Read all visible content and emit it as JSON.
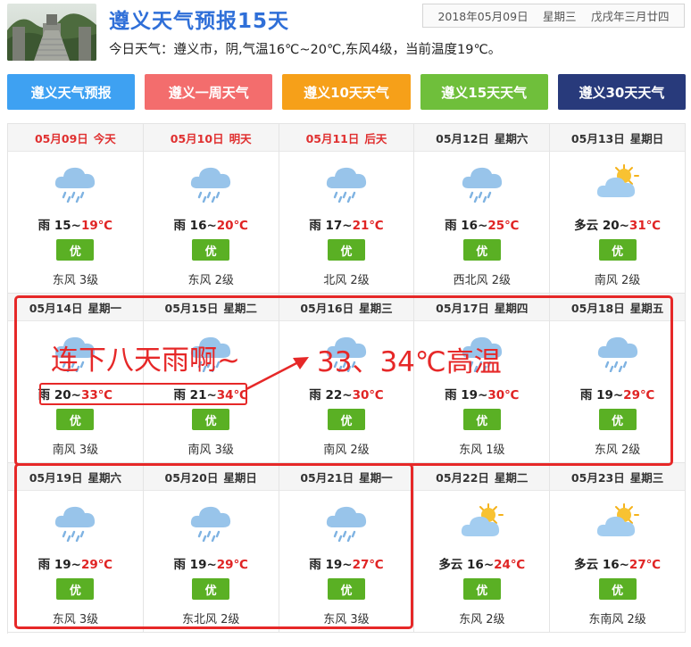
{
  "header": {
    "title": "遵义天气预报15天",
    "summary": "今日天气：遵义市，阴,气温16℃~20℃,东风4级，当前温度19℃。",
    "date": "2018年05月09日",
    "weekday": "星期三",
    "lunar": "戊戌年三月廿四"
  },
  "tabs": [
    {
      "label": "遵义天气预报"
    },
    {
      "label": "遵义一周天气"
    },
    {
      "label": "遵义10天天气"
    },
    {
      "label": "遵义15天天气"
    },
    {
      "label": "遵义30天天气"
    }
  ],
  "days": [
    {
      "date": "05月09日",
      "label": "今天",
      "today": true,
      "icon": "rain-cloud-icon",
      "weather": "雨",
      "low": "15",
      "high": "19℃",
      "aq": "优",
      "wind": "东风 3级"
    },
    {
      "date": "05月10日",
      "label": "明天",
      "today": true,
      "icon": "rain-cloud-icon",
      "weather": "雨",
      "low": "16",
      "high": "20℃",
      "aq": "优",
      "wind": "东风 2级"
    },
    {
      "date": "05月11日",
      "label": "后天",
      "today": true,
      "icon": "rain-cloud-icon",
      "weather": "雨",
      "low": "17",
      "high": "21℃",
      "aq": "优",
      "wind": "北风 2级"
    },
    {
      "date": "05月12日",
      "label": "星期六",
      "today": false,
      "icon": "rain-cloud-icon",
      "weather": "雨",
      "low": "16",
      "high": "25℃",
      "aq": "优",
      "wind": "西北风 2级"
    },
    {
      "date": "05月13日",
      "label": "星期日",
      "today": false,
      "icon": "partly-cloudy-icon",
      "weather": "多云",
      "low": "20",
      "high": "31℃",
      "aq": "优",
      "wind": "南风 2级"
    },
    {
      "date": "05月14日",
      "label": "星期一",
      "today": false,
      "icon": "rain-cloud-icon",
      "weather": "雨",
      "low": "20",
      "high": "33℃",
      "aq": "优",
      "wind": "南风 3级"
    },
    {
      "date": "05月15日",
      "label": "星期二",
      "today": false,
      "icon": "rain-cloud-icon",
      "weather": "雨",
      "low": "21",
      "high": "34℃",
      "aq": "优",
      "wind": "南风 3级"
    },
    {
      "date": "05月16日",
      "label": "星期三",
      "today": false,
      "icon": "rain-cloud-icon",
      "weather": "雨",
      "low": "22",
      "high": "30℃",
      "aq": "优",
      "wind": "南风 2级"
    },
    {
      "date": "05月17日",
      "label": "星期四",
      "today": false,
      "icon": "rain-cloud-icon",
      "weather": "雨",
      "low": "19",
      "high": "30℃",
      "aq": "优",
      "wind": "东风 1级"
    },
    {
      "date": "05月18日",
      "label": "星期五",
      "today": false,
      "icon": "rain-cloud-icon",
      "weather": "雨",
      "low": "19",
      "high": "29℃",
      "aq": "优",
      "wind": "东风 2级"
    },
    {
      "date": "05月19日",
      "label": "星期六",
      "today": false,
      "icon": "rain-cloud-icon",
      "weather": "雨",
      "low": "19",
      "high": "29℃",
      "aq": "优",
      "wind": "东风 3级"
    },
    {
      "date": "05月20日",
      "label": "星期日",
      "today": false,
      "icon": "rain-cloud-icon",
      "weather": "雨",
      "low": "19",
      "high": "29℃",
      "aq": "优",
      "wind": "东北风 2级"
    },
    {
      "date": "05月21日",
      "label": "星期一",
      "today": false,
      "icon": "rain-cloud-icon",
      "weather": "雨",
      "low": "19",
      "high": "27℃",
      "aq": "优",
      "wind": "东风 3级"
    },
    {
      "date": "05月22日",
      "label": "星期二",
      "today": false,
      "icon": "partly-cloudy-icon",
      "weather": "多云",
      "low": "16",
      "high": "24℃",
      "aq": "优",
      "wind": "东风 2级"
    },
    {
      "date": "05月23日",
      "label": "星期三",
      "today": false,
      "icon": "partly-cloudy-icon",
      "weather": "多云",
      "low": "16",
      "high": "27℃",
      "aq": "优",
      "wind": "东南风 2级"
    }
  ],
  "annotations": {
    "rain_note": "连下八天雨啊~",
    "heat_note": "33、34℃高温",
    "color": "#e62828"
  }
}
